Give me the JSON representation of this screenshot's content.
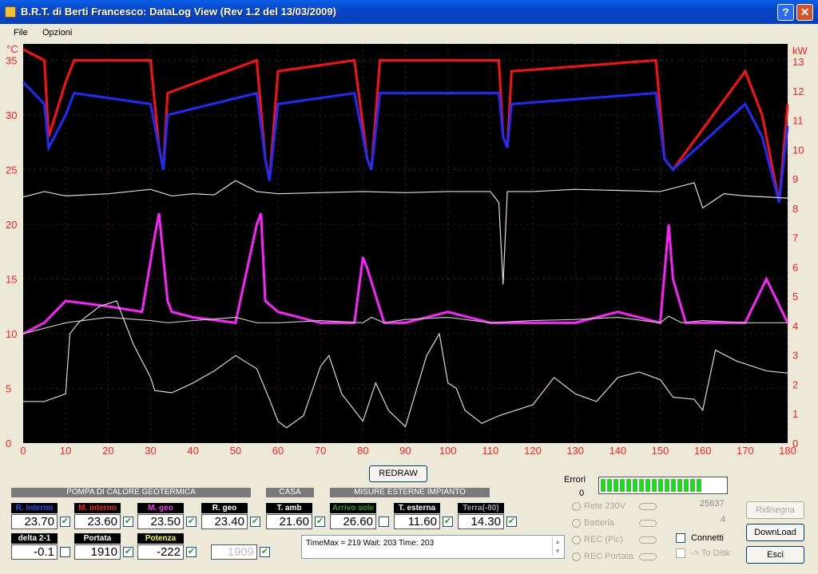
{
  "window": {
    "title": "B.R.T. di Berti Francesco: DataLog View  (Rev 1.2 del 13/03/2009)"
  },
  "menu": {
    "file": "File",
    "options": "Opzioni"
  },
  "chart_data": {
    "type": "line",
    "xlim": [
      0,
      180
    ],
    "ylim_left": [
      0,
      35
    ],
    "ylim_right": [
      0,
      13
    ],
    "left_unit": "°C",
    "right_unit": "kW",
    "x_ticks": [
      0,
      10,
      20,
      30,
      40,
      50,
      60,
      70,
      80,
      90,
      100,
      110,
      120,
      130,
      140,
      150,
      160,
      170,
      180
    ],
    "left_ticks": [
      0,
      5,
      10,
      15,
      20,
      25,
      30,
      35
    ],
    "right_ticks": [
      0,
      1,
      2,
      3,
      4,
      5,
      6,
      7,
      8,
      9,
      10,
      11,
      12,
      13
    ],
    "grid": "dotted red",
    "series": [
      {
        "color": "#ff1010",
        "x": [
          0,
          5,
          6,
          10,
          12,
          30,
          32,
          33,
          34,
          55,
          57,
          58,
          60,
          78,
          81,
          82,
          84,
          112,
          113,
          114,
          115,
          149,
          151,
          153,
          170,
          174,
          178,
          180
        ],
        "y": [
          36,
          35,
          28,
          33,
          35,
          35,
          27,
          25,
          32,
          35,
          26,
          24,
          34,
          35,
          26,
          25,
          35,
          35,
          28,
          27,
          34,
          35,
          26,
          25,
          34,
          30,
          22,
          31
        ]
      },
      {
        "color": "#1f2bff",
        "x": [
          0,
          5,
          6,
          10,
          12,
          30,
          32,
          33,
          34,
          55,
          57,
          58,
          60,
          78,
          81,
          82,
          84,
          112,
          113,
          114,
          115,
          149,
          151,
          153,
          170,
          174,
          178,
          180
        ],
        "y": [
          33,
          31,
          27,
          30,
          32,
          31,
          27,
          25,
          30,
          32,
          26,
          24,
          31,
          32,
          26,
          25,
          32,
          32,
          28,
          27,
          31,
          32,
          26,
          25,
          31,
          28,
          22,
          29
        ]
      },
      {
        "color": "#e0e0e0",
        "x": [
          0,
          5,
          10,
          20,
          30,
          35,
          40,
          45,
          50,
          55,
          60,
          70,
          80,
          90,
          100,
          110,
          112,
          113,
          114,
          120,
          130,
          150,
          158,
          160,
          165,
          170,
          180
        ],
        "y": [
          22.5,
          23,
          22.6,
          22.8,
          23.2,
          22.6,
          22.8,
          22.7,
          24,
          23,
          22.8,
          22.9,
          23,
          22.9,
          23,
          23,
          22,
          14.5,
          23,
          23,
          23.2,
          23,
          23.8,
          21.5,
          22.8,
          22.6,
          22.4
        ]
      },
      {
        "color": "#ff20ff",
        "x": [
          0,
          5,
          10,
          20,
          28,
          31,
          32,
          34,
          35,
          40,
          50,
          55,
          56,
          57,
          60,
          70,
          78,
          80,
          81,
          85,
          90,
          100,
          110,
          120,
          130,
          140,
          150,
          152,
          153,
          156,
          160,
          170,
          175,
          180
        ],
        "y": [
          10,
          11,
          13,
          12.5,
          12,
          19,
          21,
          13,
          12,
          11.5,
          11,
          20,
          21,
          13,
          12,
          11,
          11,
          17,
          16,
          11,
          11,
          12,
          11,
          11,
          11,
          12,
          11,
          20,
          15,
          11,
          11,
          11,
          15,
          11
        ]
      },
      {
        "color": "#c8c8c8",
        "x": [
          0,
          5,
          10,
          20,
          30,
          34,
          40,
          50,
          55,
          60,
          70,
          80,
          82,
          85,
          90,
          100,
          110,
          120,
          130,
          140,
          150,
          152,
          155,
          160,
          170,
          180
        ],
        "y": [
          10,
          10.5,
          11,
          11.5,
          11.2,
          11,
          11.2,
          11.5,
          11,
          11,
          11.2,
          11,
          11.5,
          11,
          11.3,
          11.5,
          11,
          11.2,
          11.3,
          11.5,
          11,
          11.6,
          11,
          11.2,
          11,
          11
        ]
      },
      {
        "color": "#d8d8d8",
        "x": [
          0,
          5,
          10,
          11,
          13,
          18,
          22,
          26,
          30,
          31,
          35,
          40,
          45,
          50,
          55,
          58,
          60,
          62,
          66,
          70,
          72,
          75,
          80,
          83,
          86,
          90,
          95,
          98,
          100,
          102,
          104,
          108,
          112,
          116,
          120,
          125,
          130,
          135,
          140,
          145,
          150,
          153,
          158,
          160,
          163,
          168,
          175,
          180
        ],
        "y": [
          3.8,
          3.8,
          4.5,
          10,
          11,
          12.5,
          13,
          9,
          6,
          4.8,
          4.6,
          5.5,
          6.6,
          8,
          6.8,
          4,
          2,
          1.4,
          2.5,
          7,
          8,
          4.5,
          2,
          5.5,
          3,
          1.5,
          8,
          10,
          5.5,
          5,
          3,
          1.8,
          2.5,
          3,
          3.5,
          6,
          4.5,
          3.8,
          6,
          6.5,
          5.8,
          4.2,
          4,
          3,
          8.5,
          7.5,
          6.6,
          6.4
        ]
      }
    ]
  },
  "buttons": {
    "redraw": "REDRAW",
    "ridisegna": "Ridisegna",
    "download": "DownLoad",
    "esci": "Esci"
  },
  "sections": {
    "pompa": "POMPA DI CALORE GEOTERMICA",
    "casa": "CASA",
    "misure": "MISURE ESTERNE IMPIANTO"
  },
  "fields": [
    {
      "label": "R. Interno",
      "value": "23.70",
      "checked": true
    },
    {
      "label": "M. interno",
      "value": "23.60",
      "checked": true
    },
    {
      "label": "M. geo",
      "value": "23.50",
      "checked": true
    },
    {
      "label": "R. geo",
      "value": "23.40",
      "checked": true
    },
    {
      "label": "T. amb",
      "value": "21.60",
      "checked": true
    },
    {
      "label": "Arrivo sole",
      "value": "26.60",
      "checked": false
    },
    {
      "label": "T. esterna",
      "value": "11.60",
      "checked": true
    },
    {
      "label": "Terra(-80)",
      "value": "14.30",
      "checked": true
    },
    {
      "label": "delta 2-1",
      "value": "-0.1",
      "checked": false
    },
    {
      "label": "Portata",
      "value": "1910",
      "checked": true
    },
    {
      "label": "Potenza",
      "value": "-222",
      "checked": true
    },
    {
      "label": "",
      "value": "1909",
      "checked": true
    }
  ],
  "info_text": "TimeMax = 219  Wait: 203  Time: 203",
  "errori": {
    "label": "Errori",
    "value": "0"
  },
  "progress_level": 0.8,
  "counter": "25637",
  "count_small": "4",
  "status_rows": [
    "Rete 230V",
    "Batteria",
    "REC (Pic)",
    "REC Portata"
  ],
  "connetti": {
    "label": "Connetti",
    "checked": false
  },
  "todisk": {
    "label": "-> To Disk",
    "checked": false
  }
}
